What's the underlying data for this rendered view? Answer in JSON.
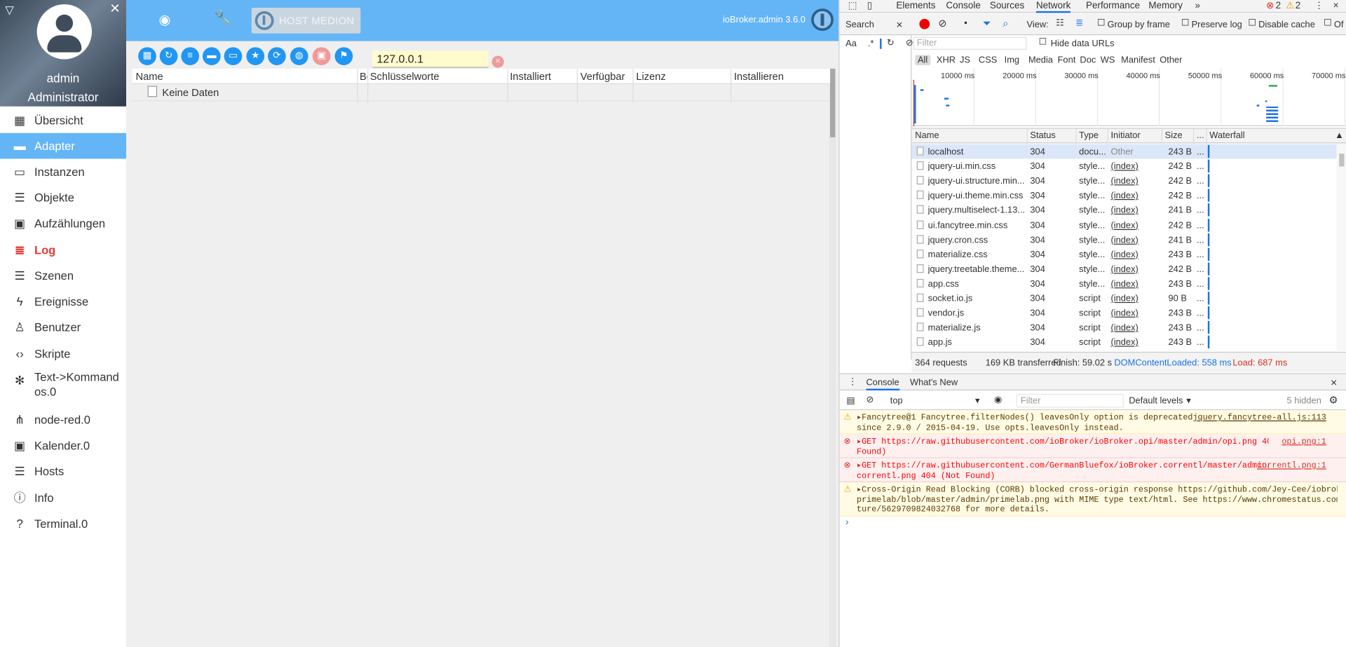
{
  "sidebar": {
    "user_name": "admin",
    "user_role": "Administrator",
    "items": [
      {
        "label": "Übersicht",
        "icon": "apps-icon"
      },
      {
        "label": "Adapter",
        "icon": "store-icon"
      },
      {
        "label": "Instanzen",
        "icon": "instances-icon"
      },
      {
        "label": "Objekte",
        "icon": "list-icon"
      },
      {
        "label": "Aufzählungen",
        "icon": "enums-icon"
      },
      {
        "label": "Log",
        "icon": "log-icon"
      },
      {
        "label": "Szenen",
        "icon": "scenes-icon"
      },
      {
        "label": "Ereignisse",
        "icon": "bolt-icon"
      },
      {
        "label": "Benutzer",
        "icon": "user-icon"
      },
      {
        "label": "Skripte",
        "icon": "code-icon"
      },
      {
        "label": "Text->Kommandos.0",
        "icon": "snowflake-icon"
      },
      {
        "label": "node-red.0",
        "icon": "node-red-icon"
      },
      {
        "label": "Kalender.0",
        "icon": "calendar-icon"
      },
      {
        "label": "Hosts",
        "icon": "hosts-icon"
      },
      {
        "label": "Info",
        "icon": "info-icon"
      },
      {
        "label": "Terminal.0",
        "icon": "help-icon"
      }
    ]
  },
  "header": {
    "host_label": "HOST MEDION",
    "version": "ioBroker.admin 3.6.0"
  },
  "adapter": {
    "filter_value": "127.0.0.1",
    "columns": [
      "Name",
      "Be",
      "Schlüsselworte",
      "Installiert",
      "Verfügbar",
      "Lizenz",
      "Installieren"
    ],
    "no_data": "Keine Daten"
  },
  "devtools": {
    "tabs": [
      "Elements",
      "Console",
      "Sources",
      "Network",
      "Performance",
      "Memory"
    ],
    "error_count": "2",
    "warning_count": "2",
    "search_label": "Search",
    "view_label": "View:",
    "group_by_frame": "Group by frame",
    "preserve_log": "Preserve log",
    "disable_cache": "Disable cache",
    "offline_cut": "Of",
    "filter_placeholder": "Filter",
    "hide_data_urls": "Hide data URLs",
    "types": [
      "All",
      "XHR",
      "JS",
      "CSS",
      "Img",
      "Media",
      "Font",
      "Doc",
      "WS",
      "Manifest",
      "Other"
    ],
    "timeline_labels": [
      "10000 ms",
      "20000 ms",
      "30000 ms",
      "40000 ms",
      "50000 ms",
      "60000 ms",
      "70000 ms"
    ],
    "columns": [
      "Name",
      "Status",
      "Type",
      "Initiator",
      "Size",
      "...",
      "Waterfall"
    ],
    "rows": [
      {
        "name": "localhost",
        "status": "304",
        "type": "docu...",
        "initiator": "Other",
        "size": "243 B"
      },
      {
        "name": "jquery-ui.min.css",
        "status": "304",
        "type": "style...",
        "initiator": "(index)",
        "size": "242 B"
      },
      {
        "name": "jquery-ui.structure.min...",
        "status": "304",
        "type": "style...",
        "initiator": "(index)",
        "size": "242 B"
      },
      {
        "name": "jquery-ui.theme.min.css",
        "status": "304",
        "type": "style...",
        "initiator": "(index)",
        "size": "242 B"
      },
      {
        "name": "jquery.multiselect-1.13....",
        "status": "304",
        "type": "style...",
        "initiator": "(index)",
        "size": "241 B"
      },
      {
        "name": "ui.fancytree.min.css",
        "status": "304",
        "type": "style...",
        "initiator": "(index)",
        "size": "242 B"
      },
      {
        "name": "jquery.cron.css",
        "status": "304",
        "type": "style...",
        "initiator": "(index)",
        "size": "241 B"
      },
      {
        "name": "materialize.css",
        "status": "304",
        "type": "style...",
        "initiator": "(index)",
        "size": "243 B"
      },
      {
        "name": "jquery.treetable.theme....",
        "status": "304",
        "type": "style...",
        "initiator": "(index)",
        "size": "242 B"
      },
      {
        "name": "app.css",
        "status": "304",
        "type": "style...",
        "initiator": "(index)",
        "size": "243 B"
      },
      {
        "name": "socket.io.js",
        "status": "304",
        "type": "script",
        "initiator": "(index)",
        "size": "90 B"
      },
      {
        "name": "vendor.js",
        "status": "304",
        "type": "script",
        "initiator": "(index)",
        "size": "243 B"
      },
      {
        "name": "materialize.js",
        "status": "304",
        "type": "script",
        "initiator": "(index)",
        "size": "243 B"
      },
      {
        "name": "app.js",
        "status": "304",
        "type": "script",
        "initiator": "(index)",
        "size": "243 B"
      }
    ],
    "status_requests": "364 requests",
    "status_transferred": "169 KB transferred",
    "status_finish": "Finish: 59.02 s",
    "status_dcl": "DOMContentLoaded: 558 ms",
    "status_load": "Load: 687 ms",
    "drawer_tabs": [
      "Console",
      "What's New"
    ],
    "context": "top",
    "console_filter": "Filter",
    "levels": "Default levels",
    "hidden": "5 hidden",
    "messages": [
      {
        "kind": "warn",
        "line1": "▸Fancytree@1 Fancytree.filterNodes() leavesOnly option is deprecated",
        "line2": "since 2.9.0 / 2015-04-19. Use opts.leavesOnly instead.",
        "line3": "",
        "source": "jquery.fancytree-all.js:113"
      },
      {
        "kind": "err",
        "line1": "▸GET https://raw.githubusercontent.com/ioBroker/ioBroker.opi/master/admin/opi.png 404 (Not",
        "line2": "Found)",
        "line3": "",
        "source": "opi.png:1"
      },
      {
        "kind": "err",
        "line1": "▸GET https://raw.githubusercontent.com/GermanBluefox/ioBroker.correntl/master/admin/",
        "line2": "correntl.png 404 (Not Found)",
        "line3": "",
        "source": "correntl.png:1"
      },
      {
        "kind": "warn",
        "line1": "▸Cross-Origin Read Blocking (CORB) blocked cross-origin response https://github.com/Jey-Cee/iobroker.",
        "line2": "primelab/blob/master/admin/primelab.png with MIME type text/html. See https://www.chromestatus.com/fea",
        "line3": "ture/5629709824032768 for more details.",
        "source": ""
      }
    ]
  }
}
